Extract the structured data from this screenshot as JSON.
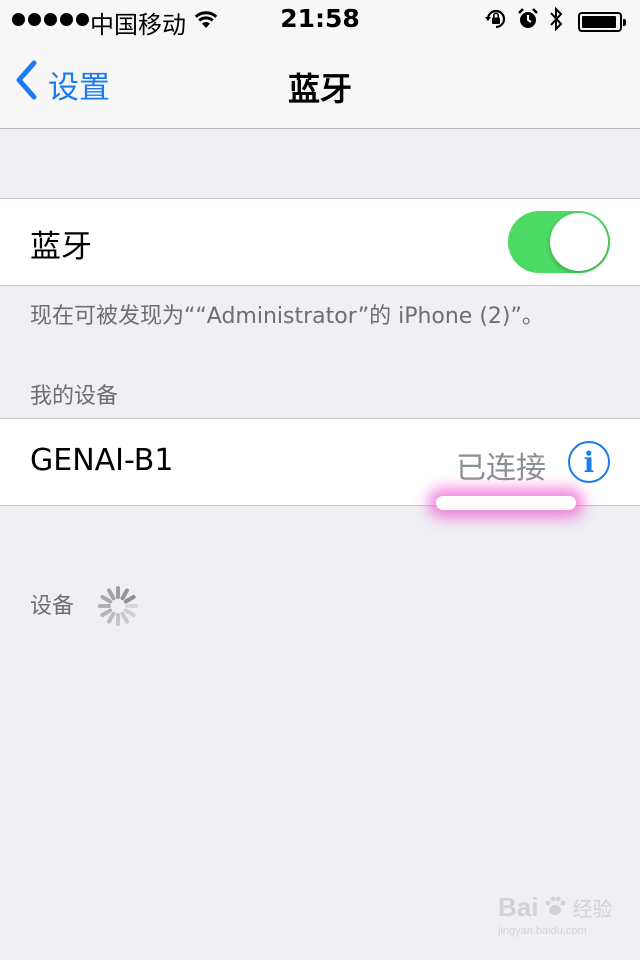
{
  "status_bar": {
    "carrier": "中国移动",
    "time": "21:58",
    "battery_level": 0.95,
    "icons": [
      "signal-dots",
      "wifi-icon",
      "orientation-lock-icon",
      "alarm-icon",
      "bluetooth-icon",
      "battery-icon"
    ]
  },
  "nav": {
    "back_label": "设置",
    "title": "蓝牙"
  },
  "bluetooth": {
    "label": "蓝牙",
    "enabled": true,
    "toggle_color": "#4cd964",
    "discoverable_text": "现在可被发现为““Administrator”的 iPhone (2)”。"
  },
  "my_devices": {
    "header": "我的设备",
    "items": [
      {
        "name": "GENAI-B1",
        "status": "已连接"
      }
    ]
  },
  "devices": {
    "header": "设备"
  },
  "watermark": {
    "brand": "Bai",
    "label": "经验",
    "url": "jingyan.baidu.com"
  },
  "colors": {
    "accent": "#1a7cf0",
    "background": "#efeff4",
    "highlight": "#ec46c8"
  }
}
